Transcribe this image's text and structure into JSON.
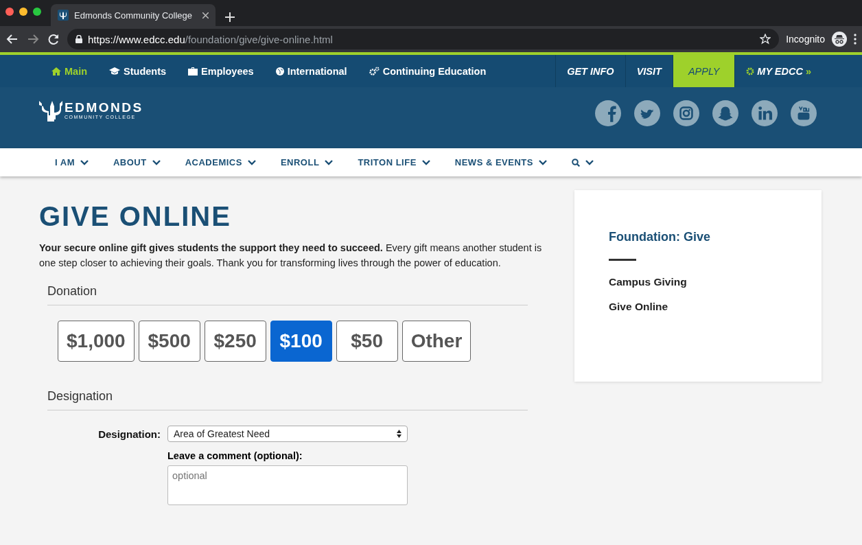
{
  "browser": {
    "tab_title": "Edmonds Community College",
    "url_host": "https://www.edcc.edu",
    "url_path": "/foundation/give/give-online.html",
    "profile": "Incognito"
  },
  "top_nav": {
    "items": [
      {
        "label": "Main",
        "selected": true
      },
      {
        "label": "Students",
        "selected": false
      },
      {
        "label": "Employees",
        "selected": false
      },
      {
        "label": "International",
        "selected": false
      },
      {
        "label": "Continuing Education",
        "selected": false
      }
    ],
    "actions": [
      {
        "label": "GET INFO",
        "kind": "plain"
      },
      {
        "label": "VISIT",
        "kind": "plain"
      },
      {
        "label": "APPLY",
        "kind": "highlight"
      },
      {
        "label": "MY EDCC",
        "kind": "portal",
        "suffix": "»"
      }
    ]
  },
  "header": {
    "logo_name": "EDMONDS",
    "logo_sub": "COMMUNITY COLLEGE"
  },
  "main_nav": [
    "I AM",
    "ABOUT",
    "ACADEMICS",
    "ENROLL",
    "TRITON LIFE",
    "NEWS & EVENTS"
  ],
  "page": {
    "title": "GIVE ONLINE",
    "intro": "**Your secure online gift gives students the support they need to succeed.** Every gift means another student is one step closer to achieving their goals. Thank you for transforming lives through the power of education."
  },
  "donation": {
    "heading": "Donation",
    "amounts": [
      {
        "label": "$1,000",
        "selected": false
      },
      {
        "label": "$500",
        "selected": false
      },
      {
        "label": "$250",
        "selected": false
      },
      {
        "label": "$100",
        "selected": true
      },
      {
        "label": "$50",
        "selected": false
      },
      {
        "label": "Other",
        "selected": false
      }
    ]
  },
  "designation": {
    "heading": "Designation",
    "field_label": "Designation:",
    "value": "Area of Greatest Need",
    "comment_label": "Leave a comment (optional):",
    "comment_placeholder": "optional"
  },
  "sidebar": {
    "title": "Foundation: Give",
    "links": [
      "Campus Giving",
      "Give Online"
    ]
  }
}
